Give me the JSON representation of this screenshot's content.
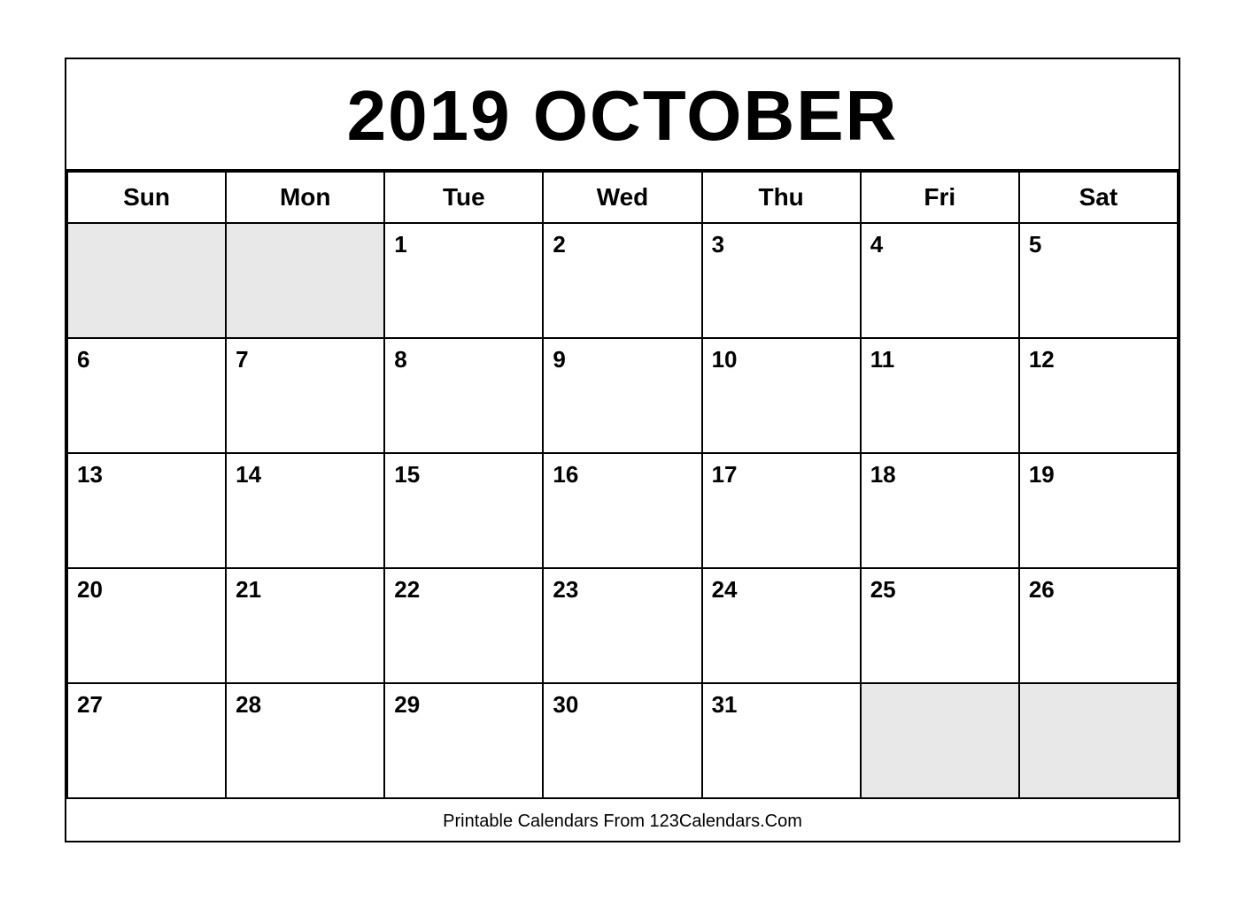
{
  "calendar": {
    "title": "2019 OCTOBER",
    "days_of_week": [
      "Sun",
      "Mon",
      "Tue",
      "Wed",
      "Thu",
      "Fri",
      "Sat"
    ],
    "weeks": [
      [
        {
          "day": "",
          "empty": true
        },
        {
          "day": "",
          "empty": true
        },
        {
          "day": "1",
          "empty": false
        },
        {
          "day": "2",
          "empty": false
        },
        {
          "day": "3",
          "empty": false
        },
        {
          "day": "4",
          "empty": false
        },
        {
          "day": "5",
          "empty": false
        }
      ],
      [
        {
          "day": "6",
          "empty": false
        },
        {
          "day": "7",
          "empty": false
        },
        {
          "day": "8",
          "empty": false
        },
        {
          "day": "9",
          "empty": false
        },
        {
          "day": "10",
          "empty": false
        },
        {
          "day": "11",
          "empty": false
        },
        {
          "day": "12",
          "empty": false
        }
      ],
      [
        {
          "day": "13",
          "empty": false
        },
        {
          "day": "14",
          "empty": false
        },
        {
          "day": "15",
          "empty": false
        },
        {
          "day": "16",
          "empty": false
        },
        {
          "day": "17",
          "empty": false
        },
        {
          "day": "18",
          "empty": false
        },
        {
          "day": "19",
          "empty": false
        }
      ],
      [
        {
          "day": "20",
          "empty": false
        },
        {
          "day": "21",
          "empty": false
        },
        {
          "day": "22",
          "empty": false
        },
        {
          "day": "23",
          "empty": false
        },
        {
          "day": "24",
          "empty": false
        },
        {
          "day": "25",
          "empty": false
        },
        {
          "day": "26",
          "empty": false
        }
      ],
      [
        {
          "day": "27",
          "empty": false
        },
        {
          "day": "28",
          "empty": false
        },
        {
          "day": "29",
          "empty": false
        },
        {
          "day": "30",
          "empty": false
        },
        {
          "day": "31",
          "empty": false
        },
        {
          "day": "",
          "empty": true
        },
        {
          "day": "",
          "empty": true
        }
      ]
    ],
    "footer": "Printable Calendars From 123Calendars.Com"
  }
}
